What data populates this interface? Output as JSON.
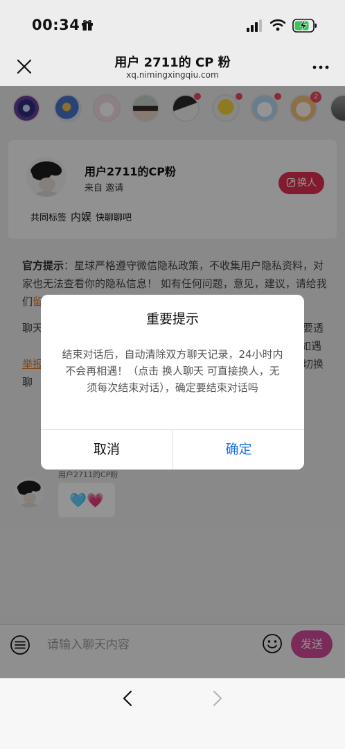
{
  "status_bar": {
    "time": "00:34"
  },
  "nav": {
    "title": "用户 2711的 CP 粉",
    "subtitle": "xq.nimingxingqiu.com"
  },
  "avatar_strip": {
    "badge_count": "2"
  },
  "profile": {
    "name": "用户2711的CP粉",
    "source": "来自 邀请",
    "swap_label": "换人",
    "tags_label": "共同标签",
    "tag_main": "内娱",
    "tag_extra": "快聊聊吧"
  },
  "notice": {
    "head": "官方提示",
    "text": "：星球严格遵守微信隐私政策，不收集用户隐私资料，对家也无法查看你的隐私信息！ 如有任何问题，意见，建议，请给我们",
    "link": "留言",
    "para2_a": "聊天",
    "para2_b": "不要透",
    "para2_c": "骗；如遇",
    "para2_link": "举报",
    "para2_d": "！",
    "para2_e": "切换聊"
  },
  "message": {
    "sender": "用户2711的CP粉",
    "content": "🩵💗"
  },
  "input": {
    "placeholder": "请输入聊天内容",
    "send_label": "发送"
  },
  "dialog": {
    "title": "重要提示",
    "body": "结束对话后，自动清除双方聊天记录，24小时内不会再相遇！（点击 换人聊天 可直接换人，无须每次结束对话），确定要结束对话吗",
    "cancel_label": "取消",
    "confirm_label": "确定"
  },
  "colors": {
    "accent_red": "#e02f52",
    "send_purple": "#d24a9b",
    "confirm_blue": "#1a73e8",
    "link_orange": "#e07020"
  },
  "icons": [
    "gift-icon",
    "signal-icon",
    "wifi-icon",
    "battery-charging-icon",
    "close-icon",
    "more-icon",
    "menu-icon",
    "emoji-icon",
    "back-icon",
    "forward-icon"
  ]
}
